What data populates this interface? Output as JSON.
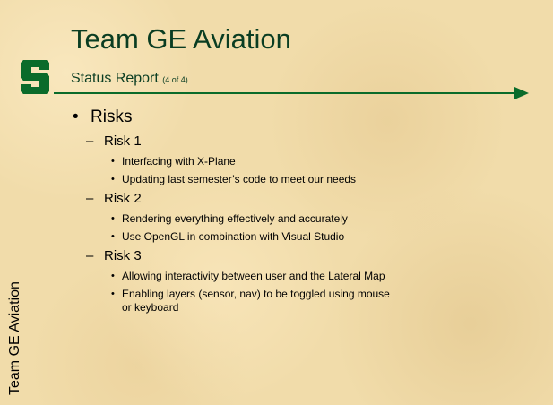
{
  "slide": {
    "title": "Team GE Aviation",
    "subtitle": "Status Report",
    "subtitle_small": "(4 of 4)",
    "side_label": "Team GE Aviation",
    "logo_letter": "S",
    "colors": {
      "green": "#0a6b2a",
      "title": "#0a3d22",
      "background": "#f1dcaa"
    }
  },
  "content": {
    "heading": "Risks",
    "risks": [
      {
        "label": "Risk 1",
        "items": [
          "Interfacing with X-Plane",
          "Updating last semester’s code to meet our needs"
        ]
      },
      {
        "label": "Risk 2",
        "items": [
          "Rendering everything effectively and accurately",
          "Use OpenGL in combination with Visual Studio"
        ]
      },
      {
        "label": "Risk 3",
        "items": [
          "Allowing interactivity between user and the Lateral Map",
          "Enabling layers (sensor, nav) to be toggled using mouse",
          "or keyboard"
        ]
      }
    ]
  }
}
